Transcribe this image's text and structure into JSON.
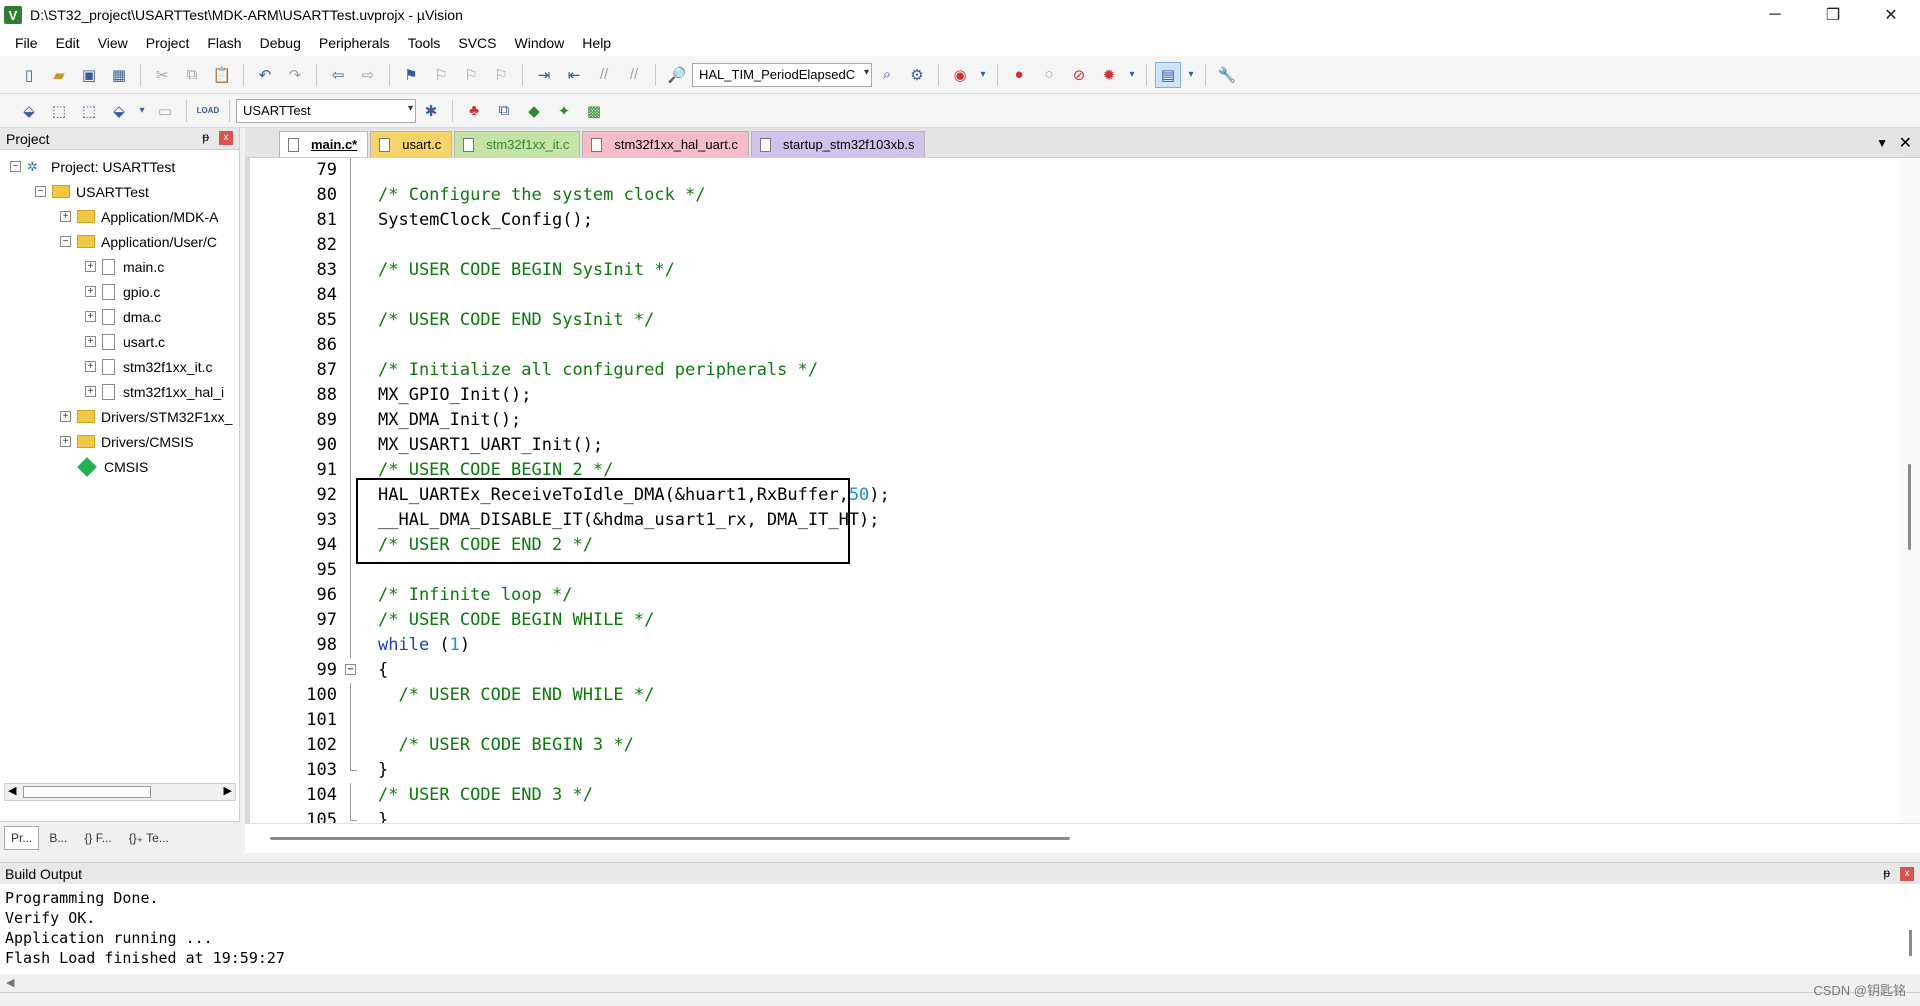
{
  "window": {
    "title": "D:\\ST32_project\\USARTTest\\MDK-ARM\\USARTTest.uvprojx - µVision",
    "app_icon": "V",
    "minimize": "─",
    "restore": "❐",
    "close": "✕"
  },
  "menu": [
    "File",
    "Edit",
    "View",
    "Project",
    "Flash",
    "Debug",
    "Peripherals",
    "Tools",
    "SVCS",
    "Window",
    "Help"
  ],
  "toolbar1": {
    "find_combo_value": "HAL_TIM_PeriodElapsedC"
  },
  "toolbar2": {
    "target_combo_value": "USARTTest",
    "load_label": "LOAD"
  },
  "project_panel": {
    "title": "Project",
    "pin": "ᵽ",
    "close": "x",
    "tree": [
      {
        "label": "Project: USARTTest",
        "expander": "−"
      },
      {
        "label": "USARTTest",
        "expander": "−"
      },
      {
        "label": "Application/MDK-A",
        "expander": "+"
      },
      {
        "label": "Application/User/C",
        "expander": "−"
      },
      {
        "label": "main.c",
        "expander": "+"
      },
      {
        "label": "gpio.c",
        "expander": "+"
      },
      {
        "label": "dma.c",
        "expander": "+"
      },
      {
        "label": "usart.c",
        "expander": "+"
      },
      {
        "label": "stm32f1xx_it.c",
        "expander": "+"
      },
      {
        "label": "stm32f1xx_hal_i",
        "expander": "+"
      },
      {
        "label": "Drivers/STM32F1xx_",
        "expander": "+"
      },
      {
        "label": "Drivers/CMSIS",
        "expander": "+"
      },
      {
        "label": "CMSIS",
        "expander": ""
      }
    ],
    "tabs": [
      "Pr...",
      "B...",
      "{} F...",
      "{}₊ Te..."
    ]
  },
  "editor": {
    "tabs": [
      {
        "label": "main.c*",
        "color": "active"
      },
      {
        "label": "usart.c",
        "color": "yellow"
      },
      {
        "label": "stm32f1xx_it.c",
        "color": "green"
      },
      {
        "label": "stm32f1xx_hal_uart.c",
        "color": "pink"
      },
      {
        "label": "startup_stm32f103xb.s",
        "color": "purple"
      }
    ],
    "tab_menu_arrow": "▼",
    "tab_close": "✕",
    "lines": [
      {
        "n": "79",
        "text": ""
      },
      {
        "n": "80",
        "text": "/* Configure the system clock */"
      },
      {
        "n": "81",
        "text": "SystemClock_Config();"
      },
      {
        "n": "82",
        "text": ""
      },
      {
        "n": "83",
        "text": "/* USER CODE BEGIN SysInit */"
      },
      {
        "n": "84",
        "text": ""
      },
      {
        "n": "85",
        "text": "/* USER CODE END SysInit */"
      },
      {
        "n": "86",
        "text": ""
      },
      {
        "n": "87",
        "text": "/* Initialize all configured peripherals */"
      },
      {
        "n": "88",
        "text": "MX_GPIO_Init();"
      },
      {
        "n": "89",
        "text": "MX_DMA_Init();"
      },
      {
        "n": "90",
        "text": "MX_USART1_UART_Init();"
      },
      {
        "n": "91",
        "text": "/* USER CODE BEGIN 2 */"
      },
      {
        "n": "92",
        "text": "HAL_UARTEx_ReceiveToIdle_DMA(&huart1,RxBuffer,",
        "num": "50",
        "rest": ");"
      },
      {
        "n": "93",
        "text": "__HAL_DMA_DISABLE_IT(&hdma_usart1_rx, DMA_IT_HT);"
      },
      {
        "n": "94",
        "text": "/* USER CODE END 2 */"
      },
      {
        "n": "95",
        "text": ""
      },
      {
        "n": "96",
        "text": "/* Infinite loop */"
      },
      {
        "n": "97",
        "text": "/* USER CODE BEGIN WHILE */"
      },
      {
        "n": "98",
        "kw": "while",
        "text": " (",
        "num": "1",
        "rest": ")"
      },
      {
        "n": "99",
        "text": "{"
      },
      {
        "n": "100",
        "text": "  /* USER CODE END WHILE */"
      },
      {
        "n": "101",
        "text": ""
      },
      {
        "n": "102",
        "text": "  /* USER CODE BEGIN 3 */"
      },
      {
        "n": "103",
        "text": "}"
      },
      {
        "n": "104",
        "text": "/* USER CODE END 3 */"
      },
      {
        "n": "105",
        "text": "}"
      }
    ]
  },
  "build_output": {
    "title": "Build Output",
    "lines": [
      "Programming Done.",
      "Verify OK.",
      "Application running ...",
      "Flash Load finished at 19:59:27"
    ]
  },
  "watermark": "CSDN @钥匙铭"
}
